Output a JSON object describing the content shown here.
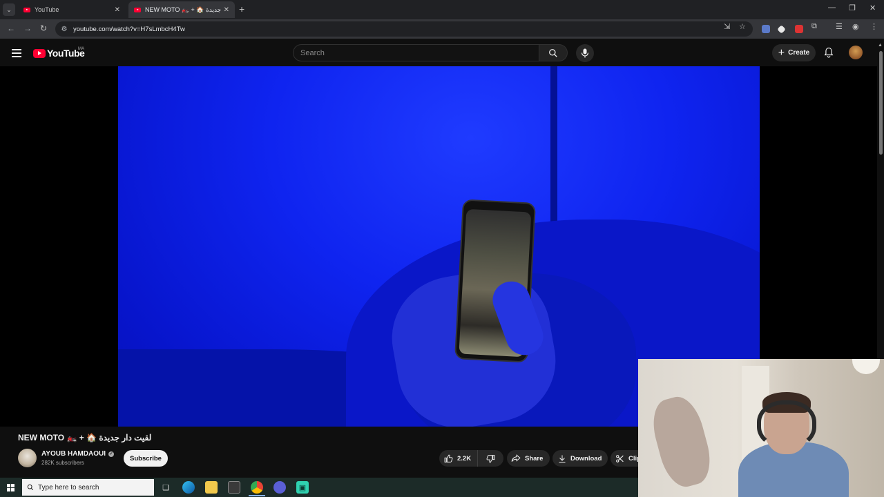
{
  "browser": {
    "tabs": [
      {
        "title": "YouTube",
        "active": false
      },
      {
        "title": "NEW MOTO 🏍️ + 🏠 دار جديدة",
        "active": true
      }
    ],
    "url": "youtube.com/watch?v=H7sLmbcH4Tw"
  },
  "masthead": {
    "logo_text": "YouTube",
    "country_code": "MA",
    "search_placeholder": "Search",
    "create_label": "Create"
  },
  "video": {
    "title": "NEW MOTO 🏍️ + 🏠 لقيت دار جديدة",
    "channel_name": "AYOUB HAMDAOUI",
    "subscribers": "282K subscribers",
    "subscribe_label": "Subscribe",
    "likes": "2.2K",
    "share_label": "Share",
    "download_label": "Download",
    "clip_label": "Clip"
  },
  "taskbar": {
    "search_placeholder": "Type here to search"
  },
  "colors": {
    "youtube_red": "#ff0033",
    "background": "#0f0f0f",
    "video_tint": "#0c1be0"
  }
}
